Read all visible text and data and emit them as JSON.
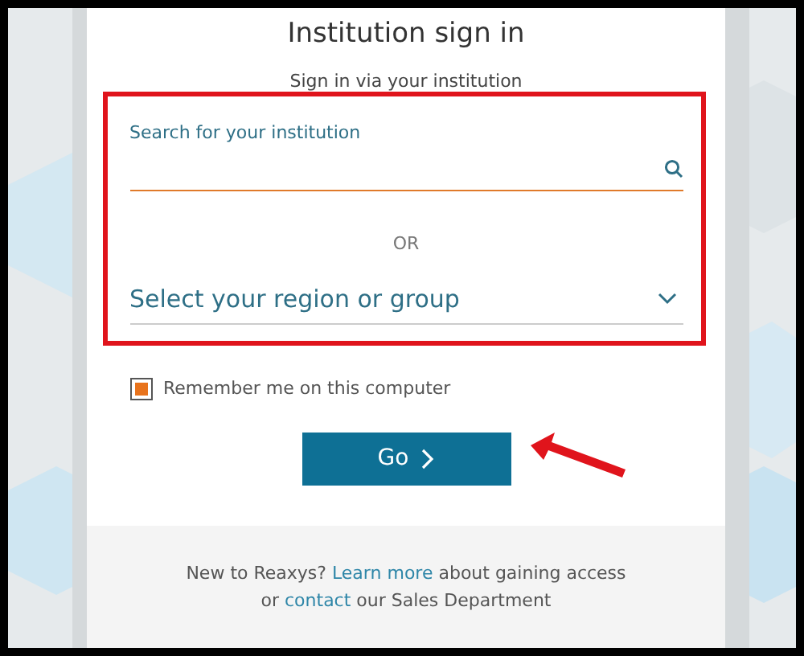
{
  "title": "Institution sign in",
  "subtitle": "Sign in via your institution",
  "search": {
    "placeholder": "Search for your institution"
  },
  "separator": "OR",
  "region_select": {
    "value": "Select your region or group"
  },
  "remember": {
    "label": "Remember me on this computer",
    "checked": true
  },
  "go_button": {
    "label": "Go"
  },
  "footer": {
    "lines": [
      [
        {
          "kind": "text",
          "text": "New to Reaxys? "
        },
        {
          "kind": "link",
          "text": "Learn more"
        },
        {
          "kind": "text",
          "text": " about gaining access"
        }
      ],
      [
        {
          "kind": "text",
          "text": "or "
        },
        {
          "kind": "link",
          "text": "contact"
        },
        {
          "kind": "text",
          "text": " our Sales Department"
        }
      ]
    ]
  }
}
